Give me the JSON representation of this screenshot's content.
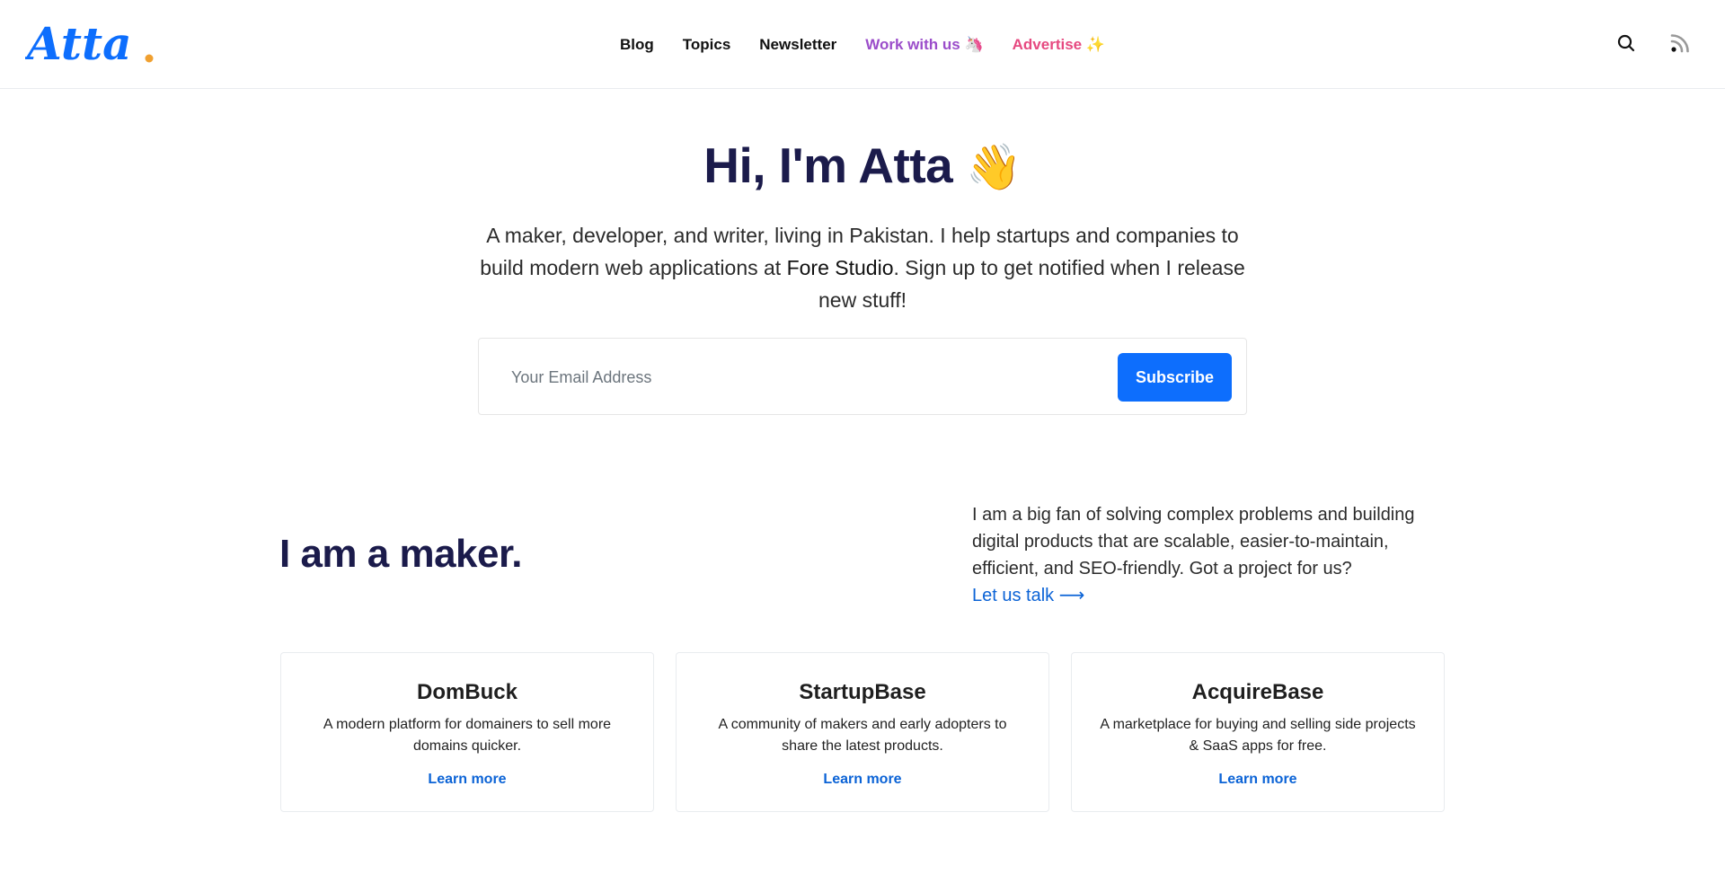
{
  "header": {
    "logo_text": "Atta",
    "nav": [
      {
        "label": "Blog"
      },
      {
        "label": "Topics"
      },
      {
        "label": "Newsletter"
      },
      {
        "label": "Work with us 🦄",
        "color": "#9b4dca"
      },
      {
        "label": "Advertise ✨",
        "color": "#e64980"
      }
    ],
    "icons": [
      "search-icon",
      "rss-icon"
    ]
  },
  "hero": {
    "title": "Hi, I'm Atta",
    "title_emoji": "👋",
    "text_before": "A maker, developer, and writer, living in Pakistan. I help startups and companies to build modern web applications at ",
    "studio_link": "Fore Studio",
    "text_after": ". Sign up to get notified when I release new stuff!"
  },
  "subscribe": {
    "placeholder": "Your Email Address",
    "value": "",
    "button_label": "Subscribe"
  },
  "maker": {
    "title": "I am a maker.",
    "text": "I am a big fan of solving complex problems and building digital products that are scalable, easier-to-maintain, efficient, and SEO-friendly. Got a project for us?",
    "link_label": "Let us talk ⟶"
  },
  "projects": [
    {
      "title": "DomBuck",
      "description": "A modern platform for domainers to sell more domains quicker.",
      "link_label": "Learn more"
    },
    {
      "title": "StartupBase",
      "description": "A community of makers and early adopters to share the latest products.",
      "link_label": "Learn more"
    },
    {
      "title": "AcquireBase",
      "description": "A marketplace for buying and selling side projects & SaaS apps for free.",
      "link_label": "Learn more"
    }
  ],
  "colors": {
    "accent_blue": "#0d6efd",
    "link_blue": "#0b63d6",
    "heading_navy": "#1b1b4b",
    "logo_dot_orange": "#f0a030"
  }
}
